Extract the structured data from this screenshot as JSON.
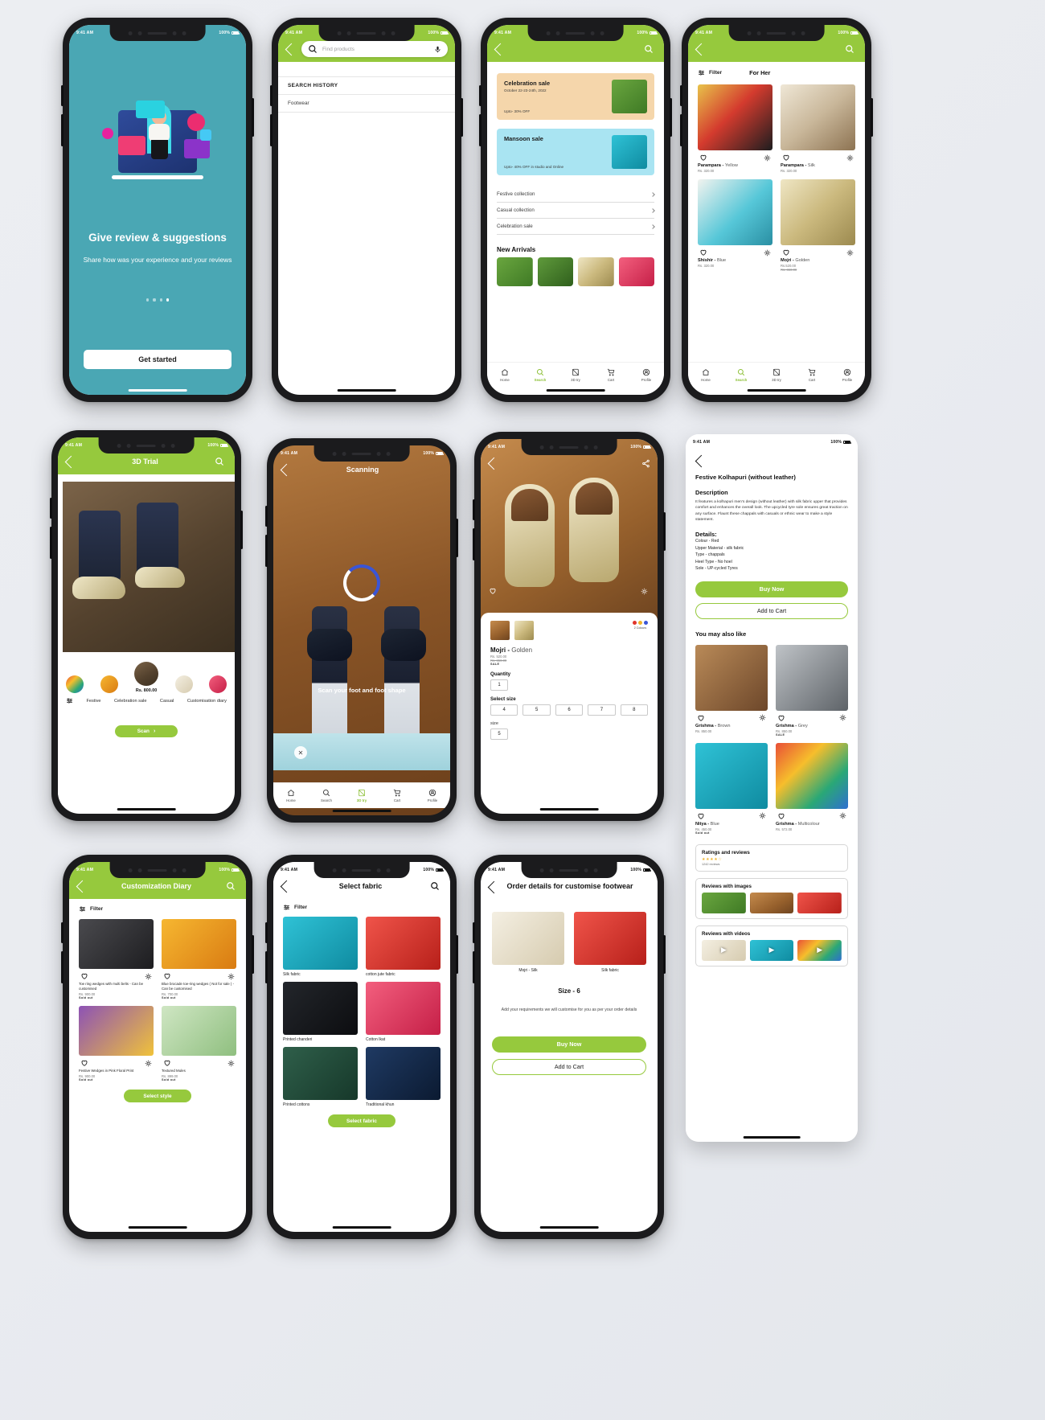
{
  "status_bar": {
    "time": "9:41 AM",
    "battery": "100%"
  },
  "phones": {
    "onboarding": {
      "title": "Give review & suggestions",
      "subtitle": "Share how was your experience and your reviews",
      "cta": "Get started",
      "dots_total": 4,
      "dots_active": 4,
      "bg_color": "#4aa7b4"
    },
    "search": {
      "placeholder": "Find products",
      "history_header": "SEARCH HISTORY",
      "history_items": [
        "Footwear"
      ]
    },
    "home": {
      "banners": [
        {
          "title": "Celebration sale",
          "date": "October 22-23-24th, 2022",
          "offer": "Upto- 30% OFF",
          "bg": "#f5d6ab"
        },
        {
          "title": "Mansoon sale",
          "date": "",
          "offer": "Upto- 40% OFF in studio and Online",
          "bg": "#a9e4f2"
        }
      ],
      "collections": [
        "Festive  collection",
        "Casual  collection",
        "Celebration sale"
      ],
      "new_arrivals_title": "New Arrivals",
      "new_arrivals_count": 4,
      "nav": [
        "Home",
        "Search",
        "3D try",
        "Cart",
        "Profile"
      ],
      "nav_active": "Search"
    },
    "for_her": {
      "filter_label": "Filter",
      "title": "For Her",
      "products": [
        {
          "name": "Parampara",
          "variant": "Yellow",
          "price": "Rs. 320.00",
          "strike": "",
          "sale": ""
        },
        {
          "name": "Parampara",
          "variant": "Silk",
          "price": "Rs. 320.00",
          "strike": "",
          "sale": ""
        },
        {
          "name": "Shishir",
          "variant": "Blue",
          "price": "Rs. 320.00",
          "strike": "",
          "sale": ""
        },
        {
          "name": "Mojri",
          "variant": "Golden",
          "price": "Rs.520.00",
          "strike": "Rs. 650.00",
          "sale": ""
        }
      ],
      "nav": [
        "Home",
        "Search",
        "3D try",
        "Cart",
        "Profile"
      ],
      "nav_active": "Search"
    },
    "trial_3d": {
      "title": "3D Trial",
      "price": "Rs. 800.00",
      "filter_label": "Filter",
      "chips": [
        "Festive",
        "Celebration sale",
        "Casual",
        "Customisation diary"
      ],
      "scan_button": "Scan"
    },
    "scanning": {
      "title": "Scanning",
      "instruction": "Scan your foot and foot shape",
      "nav": [
        "Home",
        "Search",
        "3D try",
        "Cart",
        "Profile"
      ],
      "nav_active": "3D try"
    },
    "product": {
      "name": "Mojri",
      "variant": "Golden",
      "price": "Rs. 520.00",
      "strike": "Rs. 650.00",
      "sale_tag": "SALE",
      "colours_label": "2 Colours",
      "quantity_label": "Quantity",
      "quantity_value": "1",
      "size_label": "Select size",
      "sizes": [
        "4",
        "5",
        "6",
        "7",
        "8"
      ],
      "size_label2": "size",
      "size_value": "5"
    },
    "details": {
      "title": "Festive Kolhapuri (without leather)",
      "description_heading": "Description",
      "description": "It features a kolhapuri men's design (without leather) with silk fabric upper that provides comfort and enhances the overall look. The upcycled tyre sole ensures great traction on any surface. Flaunt these chappals with casuals or ethnic wear to make a style statement.",
      "details_heading": "Details:",
      "details_list": [
        "Colour - Red",
        "Upper Material - silk fabric",
        "Type - chappals",
        "Heel  Type - No hoel",
        "Sole - UP-cycled Tyres"
      ],
      "buy_now": "Buy Now",
      "add_to_cart": "Add to Cart",
      "also_like_heading": "You may also like",
      "also_like": [
        {
          "name": "Grishma",
          "variant": "Brown",
          "price": "Rs. 850.00",
          "sale": ""
        },
        {
          "name": "Grishma",
          "variant": "Grey",
          "price": "Rs. 850.00",
          "sale": "SALE"
        },
        {
          "name": "Nitya",
          "variant": "Blue",
          "price": "Rs. 450.00",
          "sale": "Sold out"
        },
        {
          "name": "Grishma",
          "variant": "Multicolour",
          "price": "Rs. 572.00",
          "sale": ""
        }
      ],
      "ratings_heading": "Ratings and reviews",
      "ratings_count": "1242 reviews",
      "reviews_images_heading": "Reviews with images",
      "reviews_videos_heading": "Reviews with videos"
    },
    "customization_diary": {
      "title": "Customization Diary",
      "filter_label": "Filter",
      "products": [
        {
          "name": "Toe ring wedges with multi belts - Can be customised",
          "price": "Rs. 900.00",
          "sale": "Sold out"
        },
        {
          "name": "Blue brocade toe-ring wedges ( Not for sale ) - Can be customised",
          "price": "Rs. 700.00",
          "sale": "Sold out"
        },
        {
          "name": "Festive Wedges in Pink Floral Print",
          "price": "Rs. 900.00",
          "sale": "Sold out"
        },
        {
          "name": "Textured Mules",
          "price": "Rs. 899.00",
          "sale": "Sold out"
        }
      ],
      "cta": "Select style"
    },
    "select_fabric": {
      "title": "Select fabric",
      "filter_label": "Filter",
      "fabrics": [
        "Silk fabric",
        "cotton jute fabric",
        "Printed chanderi",
        "Cotton Ikat",
        "Printed cottons",
        "Traditional khun"
      ],
      "cta": "Select fabric"
    },
    "order_details": {
      "title": "Order details for customise footwear",
      "items": [
        {
          "label": "Mojri - Silk"
        },
        {
          "label": "Silk fabric"
        }
      ],
      "size_line": "Size - 6",
      "note": "Add your requirements we will customise for you as per your order details",
      "buy_now": "Buy Now",
      "add_to_cart": "Add to Cart"
    }
  },
  "colors": {
    "brand_green": "#96c93d",
    "onboarding_teal": "#4aa7b4",
    "celebration_bg": "#f5d6ab",
    "mansoon_bg": "#a9e4f2"
  }
}
